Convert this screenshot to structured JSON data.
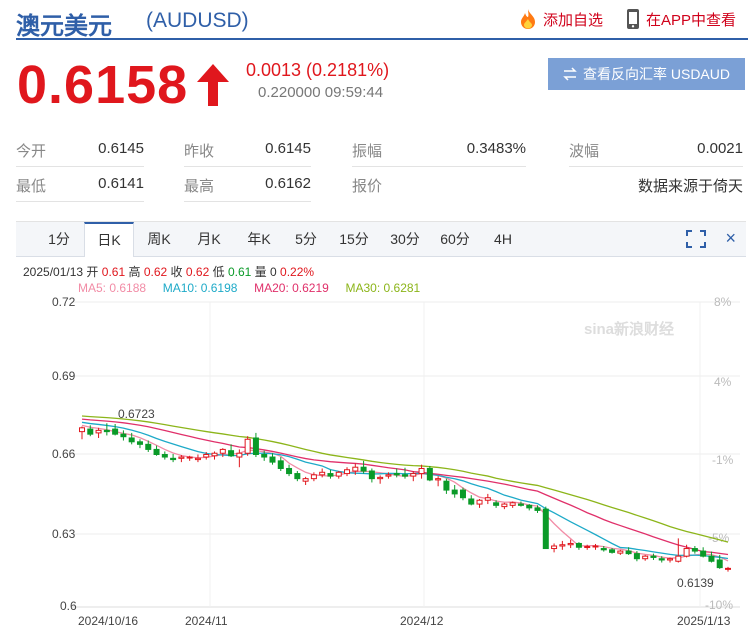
{
  "header": {
    "name": "澳元美元",
    "code": "(AUDUSD)",
    "add_watch": "添加自选",
    "view_in_app": "在APP中查看"
  },
  "quote": {
    "price": "0.6158",
    "change": "0.0013 (0.2181%)",
    "timestamp": "0.220000 09:59:44",
    "reverse_button": "查看反向汇率 USDAUD"
  },
  "stats": [
    [
      {
        "label": "今开",
        "value": "0.6145"
      },
      {
        "label": "昨收",
        "value": "0.6145"
      },
      {
        "label": "振幅",
        "value": "0.3483%"
      },
      {
        "label": "波幅",
        "value": "0.0021"
      }
    ],
    [
      {
        "label": "最低",
        "value": "0.6141"
      },
      {
        "label": "最高",
        "value": "0.6162"
      },
      {
        "label": "报价",
        "value": ""
      },
      {
        "label": "",
        "value": "数据来源于倚天"
      }
    ]
  ],
  "tabs": [
    "1分",
    "日K",
    "周K",
    "月K",
    "年K",
    "5分",
    "15分",
    "30分",
    "60分",
    "4H"
  ],
  "active_tab": "日K",
  "ohlc": {
    "date": "2025/01/13",
    "open_label": "开",
    "open": "0.61",
    "high_label": "高",
    "high": "0.62",
    "close_label": "收",
    "close": "0.62",
    "low_label": "低",
    "low": "0.61",
    "vol_label": "量",
    "vol": "0",
    "change": "0.22%"
  },
  "ma_legend": [
    {
      "label": "MA5: 0.6188",
      "color": "#f28ca6"
    },
    {
      "label": "MA10: 0.6198",
      "color": "#1eaac8"
    },
    {
      "label": "MA20: 0.6219",
      "color": "#e0306a"
    },
    {
      "label": "MA30: 0.6281",
      "color": "#8cb51a"
    }
  ],
  "watermark": "sina新浪财经",
  "colors": {
    "up": "#e0171d",
    "down": "#0a9a28",
    "brand": "#2f5fa8"
  },
  "chart_data": {
    "type": "candlestick",
    "y_ticks": [
      "0.72",
      "0.69",
      "0.66",
      "0.63",
      "0.6"
    ],
    "pct_ticks": [
      "8%",
      "4%",
      "-1%",
      "-5%",
      "-10%"
    ],
    "x_ticks": [
      "2024/10/16",
      "2024/11",
      "2024/12",
      "2025/1/13"
    ],
    "ylim": [
      0.6,
      0.72
    ],
    "annotations": [
      {
        "text": "0.6723"
      },
      {
        "text": "0.6139"
      }
    ],
    "candles": [
      [
        0.669,
        0.671,
        0.666,
        0.6705
      ],
      [
        0.67,
        0.6715,
        0.6672,
        0.668
      ],
      [
        0.6685,
        0.6705,
        0.6665,
        0.6695
      ],
      [
        0.6695,
        0.6723,
        0.6675,
        0.669
      ],
      [
        0.67,
        0.672,
        0.6675,
        0.668
      ],
      [
        0.668,
        0.6695,
        0.6655,
        0.667
      ],
      [
        0.6665,
        0.6685,
        0.664,
        0.665
      ],
      [
        0.665,
        0.666,
        0.6625,
        0.664
      ],
      [
        0.664,
        0.6655,
        0.661,
        0.662
      ],
      [
        0.662,
        0.6635,
        0.6595,
        0.66
      ],
      [
        0.66,
        0.6612,
        0.658,
        0.659
      ],
      [
        0.6585,
        0.6602,
        0.657,
        0.658
      ],
      [
        0.6585,
        0.6598,
        0.657,
        0.659
      ],
      [
        0.6588,
        0.6595,
        0.6575,
        0.659
      ],
      [
        0.658,
        0.66,
        0.657,
        0.6585
      ],
      [
        0.659,
        0.661,
        0.658,
        0.66
      ],
      [
        0.6595,
        0.6612,
        0.658,
        0.6605
      ],
      [
        0.6605,
        0.6625,
        0.659,
        0.662
      ],
      [
        0.6615,
        0.664,
        0.659,
        0.6595
      ],
      [
        0.659,
        0.662,
        0.655,
        0.6605
      ],
      [
        0.6605,
        0.6672,
        0.6595,
        0.666
      ],
      [
        0.6665,
        0.6685,
        0.659,
        0.66
      ],
      [
        0.66,
        0.6615,
        0.6575,
        0.659
      ],
      [
        0.659,
        0.6605,
        0.656,
        0.657
      ],
      [
        0.6575,
        0.659,
        0.6535,
        0.6545
      ],
      [
        0.6545,
        0.656,
        0.6515,
        0.6525
      ],
      [
        0.6525,
        0.6535,
        0.6495,
        0.6505
      ],
      [
        0.6495,
        0.6512,
        0.648,
        0.6505
      ],
      [
        0.6505,
        0.653,
        0.6495,
        0.652
      ],
      [
        0.652,
        0.6545,
        0.651,
        0.653
      ],
      [
        0.6525,
        0.654,
        0.6505,
        0.6515
      ],
      [
        0.6515,
        0.6535,
        0.6505,
        0.653
      ],
      [
        0.6525,
        0.655,
        0.6515,
        0.654
      ],
      [
        0.6535,
        0.6565,
        0.652,
        0.655
      ],
      [
        0.655,
        0.6575,
        0.6525,
        0.6535
      ],
      [
        0.6535,
        0.6545,
        0.649,
        0.6505
      ],
      [
        0.6505,
        0.6518,
        0.6485,
        0.651
      ],
      [
        0.6515,
        0.653,
        0.6505,
        0.652
      ],
      [
        0.6525,
        0.6545,
        0.651,
        0.652
      ],
      [
        0.652,
        0.6548,
        0.6505,
        0.6515
      ],
      [
        0.6515,
        0.6535,
        0.6495,
        0.6525
      ],
      [
        0.6525,
        0.656,
        0.6505,
        0.6545
      ],
      [
        0.6545,
        0.6555,
        0.6495,
        0.65
      ],
      [
        0.65,
        0.6515,
        0.6475,
        0.6505
      ],
      [
        0.6495,
        0.6505,
        0.6445,
        0.646
      ],
      [
        0.646,
        0.648,
        0.643,
        0.6445
      ],
      [
        0.646,
        0.647,
        0.642,
        0.643
      ],
      [
        0.6425,
        0.644,
        0.64,
        0.6405
      ],
      [
        0.6405,
        0.6425,
        0.639,
        0.642
      ],
      [
        0.642,
        0.6445,
        0.6405,
        0.643
      ],
      [
        0.641,
        0.642,
        0.639,
        0.64
      ],
      [
        0.6395,
        0.641,
        0.6385,
        0.6405
      ],
      [
        0.64,
        0.6415,
        0.639,
        0.641
      ],
      [
        0.6405,
        0.6415,
        0.6395,
        0.64
      ],
      [
        0.64,
        0.6405,
        0.638,
        0.639
      ],
      [
        0.639,
        0.64,
        0.637,
        0.638
      ],
      [
        0.6385,
        0.6395,
        0.629,
        0.623
      ],
      [
        0.623,
        0.625,
        0.6215,
        0.624
      ],
      [
        0.624,
        0.626,
        0.6225,
        0.6245
      ],
      [
        0.6245,
        0.6265,
        0.6232,
        0.625
      ],
      [
        0.625,
        0.6255,
        0.6225,
        0.6235
      ],
      [
        0.6235,
        0.6245,
        0.6225,
        0.6238
      ],
      [
        0.6238,
        0.6248,
        0.6225,
        0.624
      ],
      [
        0.623,
        0.624,
        0.6218,
        0.6225
      ],
      [
        0.6225,
        0.6232,
        0.621,
        0.6215
      ],
      [
        0.6212,
        0.6225,
        0.6205,
        0.622
      ],
      [
        0.622,
        0.6235,
        0.6205,
        0.621
      ],
      [
        0.621,
        0.622,
        0.618,
        0.619
      ],
      [
        0.619,
        0.6205,
        0.6182,
        0.62
      ],
      [
        0.62,
        0.621,
        0.6185,
        0.6195
      ],
      [
        0.619,
        0.62,
        0.6175,
        0.6185
      ],
      [
        0.6185,
        0.6195,
        0.6175,
        0.619
      ],
      [
        0.618,
        0.627,
        0.6175,
        0.62
      ],
      [
        0.62,
        0.6245,
        0.6195,
        0.623
      ],
      [
        0.623,
        0.624,
        0.621,
        0.622
      ],
      [
        0.622,
        0.6235,
        0.6195,
        0.62
      ],
      [
        0.62,
        0.6218,
        0.6175,
        0.618
      ],
      [
        0.6185,
        0.6205,
        0.615,
        0.6155
      ],
      [
        0.615,
        0.6158,
        0.6139,
        0.6152
      ]
    ]
  }
}
